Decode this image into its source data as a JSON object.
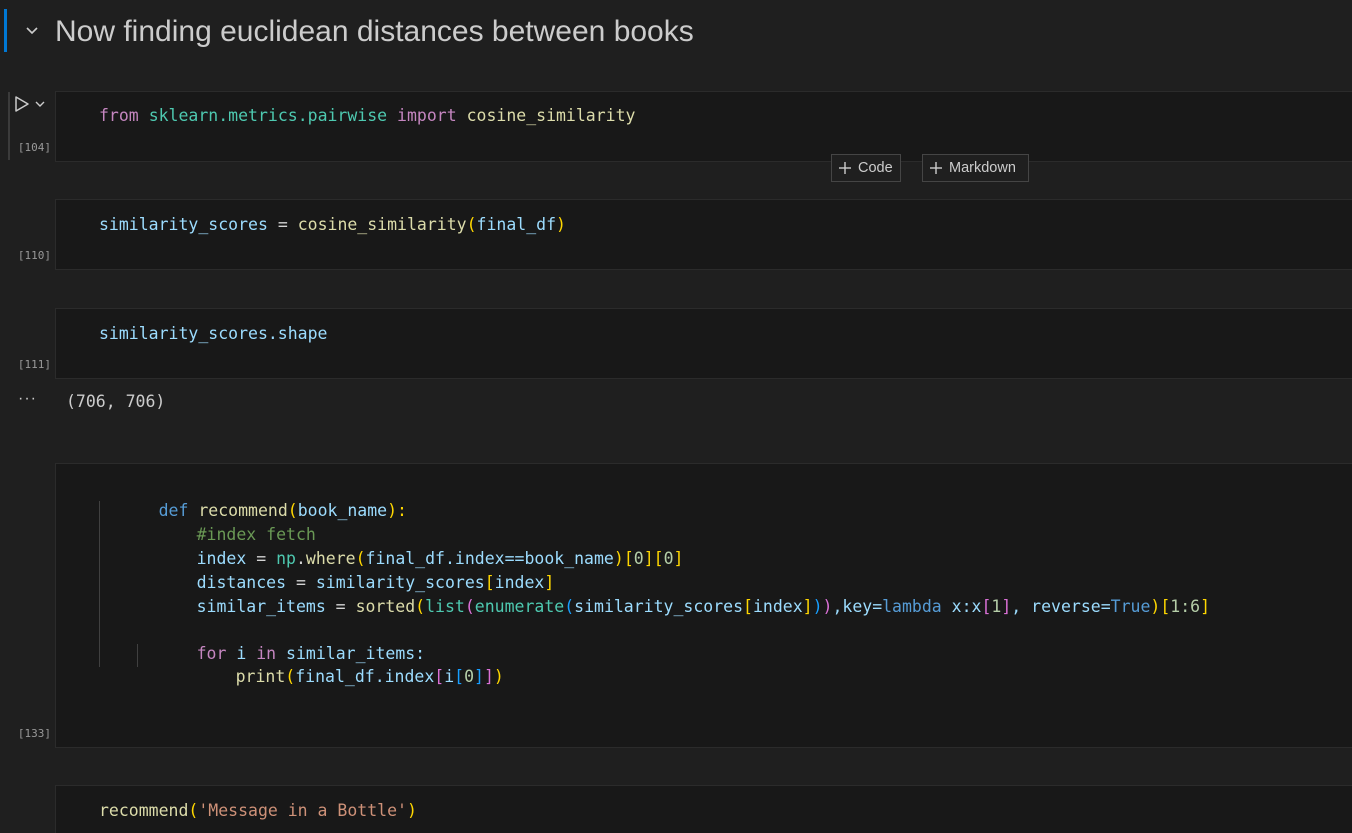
{
  "heading": {
    "text": "Now finding euclidean distances between books"
  },
  "toolbar": {
    "add_code_label": "Code",
    "add_markdown_label": "Markdown"
  },
  "cells": [
    {
      "execution_count": "[104]"
    },
    {
      "execution_count": "[110]"
    },
    {
      "execution_count": "[111]",
      "output": "(706, 706)"
    },
    {
      "execution_count": "[133]"
    }
  ],
  "output_ellipsis": "···",
  "code": {
    "c104": [
      "from",
      "sklearn.metrics.pairwise",
      "import",
      "cosine_similarity"
    ],
    "c110": [
      "similarity_scores",
      "=",
      "cosine_similarity",
      "(",
      "final_df",
      ")"
    ],
    "c111": [
      "similarity_scores.shape"
    ],
    "c133": {
      "l1": [
        "def",
        "recommend",
        "(",
        "book_name",
        "):"
      ],
      "l2": "#index fetch",
      "l3": [
        "index",
        " = ",
        "np",
        ".",
        "where",
        "(",
        "final_df.index==book_name",
        ")",
        "[",
        "0",
        "]",
        "[",
        "0",
        "]"
      ],
      "l4": [
        "distances",
        " = ",
        "similarity_scores",
        "[",
        "index",
        "]"
      ],
      "l5": [
        "similar_items",
        " = ",
        "sorted",
        "(",
        "list",
        "(",
        "enumerate",
        "(",
        "similarity_scores",
        "[",
        "index",
        "]",
        ")",
        ")",
        ",key=",
        "lambda",
        " x:x",
        "[",
        "1",
        "]",
        ", reverse=",
        "True",
        ")",
        "[",
        "1:6",
        "]"
      ],
      "l7": [
        "for",
        " i ",
        "in",
        " similar_items:"
      ],
      "l8": [
        "print",
        "(",
        "final_df.index",
        "[",
        "i",
        "[",
        "0",
        "]",
        "]",
        ")"
      ]
    },
    "c_last": [
      "recommend",
      "(",
      "'Message in a Bottle'",
      ")"
    ]
  }
}
